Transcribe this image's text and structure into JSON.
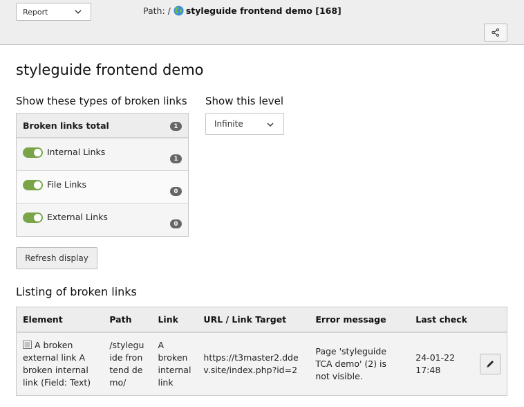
{
  "docheader": {
    "module_select": {
      "value": "Report",
      "icon": "chevron-down-icon"
    },
    "path": {
      "prefix": "Path: /",
      "icon": "globe-icon",
      "page": "styleguide frontend demo [168]"
    },
    "share_button": {
      "icon": "share-icon"
    }
  },
  "page_title": "styleguide frontend demo",
  "types_section": {
    "label": "Show these types of broken links",
    "total": {
      "label": "Broken links total",
      "count": "1"
    },
    "items": [
      {
        "label": "Internal Links",
        "enabled": true,
        "count": "1"
      },
      {
        "label": "File Links",
        "enabled": true,
        "count": "0"
      },
      {
        "label": "External Links",
        "enabled": true,
        "count": "0"
      }
    ]
  },
  "level_section": {
    "label": "Show this level",
    "select_value": "Infinite"
  },
  "refresh_label": "Refresh display",
  "listing": {
    "title": "Listing of broken links",
    "columns": [
      "Element",
      "Path",
      "Link",
      "URL / Link Target",
      "Error message",
      "Last check"
    ],
    "rows": [
      {
        "element": "A broken external link A broken internal link (Field: Text)",
        "element_icon": "content-element-icon",
        "path": "/styleguide frontend demo/",
        "link": "A broken internal link",
        "url": "https://t3master2.ddev.site/index.php?id=2",
        "error": "Page 'styleguide TCA demo' (2) is not visible.",
        "last_check": "24-01-22 17:48",
        "action_icon": "pencil-icon"
      }
    ]
  },
  "colors": {
    "toggle_on": "#79a548",
    "error_text": "#c8474b",
    "badge": "#666666",
    "docheader_bg": "#eeeeee"
  }
}
